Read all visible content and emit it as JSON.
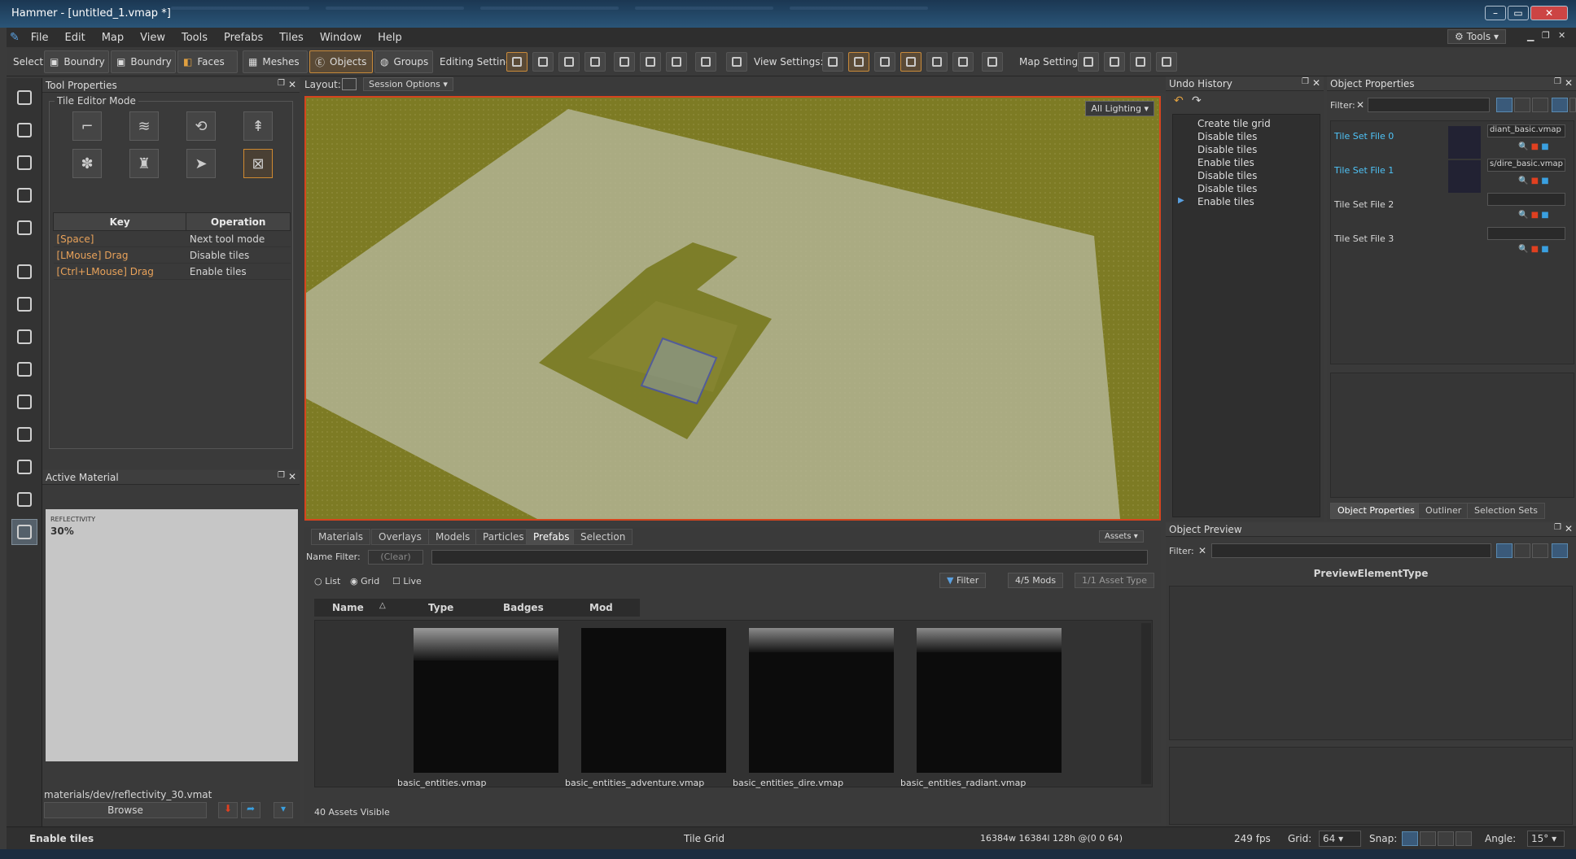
{
  "window": {
    "title": "Hammer - [untitled_1.vmap *]"
  },
  "menu": [
    "File",
    "Edit",
    "Map",
    "View",
    "Tools",
    "Prefabs",
    "Tiles",
    "Window",
    "Help"
  ],
  "menu_tools_button": "Tools",
  "toolbar": {
    "select_label": "Select:",
    "select_buttons": [
      "Boundry",
      "Boundry",
      "Faces",
      "Meshes",
      "Objects",
      "Groups"
    ],
    "editing_label": "Editing Settings:",
    "view_label": "View Settings:",
    "map_label": "Map Settings:"
  },
  "tool_properties": {
    "title": "Tool Properties",
    "group_label": "Tile Editor Mode",
    "columns": [
      "Key",
      "Operation"
    ],
    "rows": [
      {
        "key": "[Space]",
        "op": "Next tool mode"
      },
      {
        "key": "[LMouse] Drag",
        "op": "Disable tiles"
      },
      {
        "key": "[Ctrl+LMouse] Drag",
        "op": "Enable tiles"
      }
    ]
  },
  "active_material": {
    "title": "Active Material",
    "preview_label": "REFLECTIVITY",
    "preview_value": "30%",
    "path": "materials/dev/reflectivity_30.vmat",
    "browse_label": "Browse"
  },
  "viewport": {
    "layout_label": "Layout:",
    "session_options": "Session Options",
    "lighting": "All Lighting"
  },
  "asset_browser": {
    "tabs": [
      "Materials",
      "Overlays",
      "Models",
      "Particles",
      "Prefabs",
      "Selection"
    ],
    "active_tab": "Prefabs",
    "assets_dropdown": "Assets",
    "name_filter_label": "Name Filter:",
    "clear_label": "(Clear)",
    "view_modes": [
      "List",
      "Grid",
      "Live"
    ],
    "filter_btn": "Filter",
    "mods_btn": "4/5 Mods",
    "asset_type_btn": "1/1 Asset Type",
    "columns": [
      "Name",
      "Type",
      "Badges",
      "Mod"
    ],
    "items": [
      "basic_entities.vmap",
      "basic_entities_adventure.vmap",
      "basic_entities_dire.vmap",
      "basic_entities_radiant.vmap"
    ],
    "footer": "40 Assets Visible"
  },
  "undo_history": {
    "title": "Undo History",
    "items": [
      "Create tile grid",
      "Disable tiles",
      "Disable tiles",
      "Enable tiles",
      "Disable tiles",
      "Disable tiles",
      "Enable tiles"
    ]
  },
  "object_properties": {
    "title": "Object Properties",
    "filter_label": "Filter:",
    "tile_sets": [
      {
        "label": "Tile Set File 0",
        "value": "diant_basic.vmap"
      },
      {
        "label": "Tile Set File 1",
        "value": "s/dire_basic.vmap"
      },
      {
        "label": "Tile Set File 2",
        "value": ""
      },
      {
        "label": "Tile Set File 3",
        "value": ""
      }
    ],
    "bottom_tabs": [
      "Object Properties",
      "Outliner",
      "Selection Sets"
    ]
  },
  "object_preview": {
    "title": "Object Preview",
    "filter_label": "Filter:",
    "heading": "PreviewElementType"
  },
  "status": {
    "message": "Enable tiles",
    "tool": "Tile Grid",
    "dims": "16384w 16384l 128h @(0 0 64)",
    "fps": "249 fps",
    "grid_label": "Grid:",
    "grid_value": "64",
    "snap_label": "Snap:",
    "angle_label": "Angle:",
    "angle_value": "15°"
  },
  "colors": {
    "accent": "#d08a30",
    "viewport_border": "#d6451e",
    "tile_link": "#4fc3f7",
    "key_text": "#e8a25a"
  }
}
